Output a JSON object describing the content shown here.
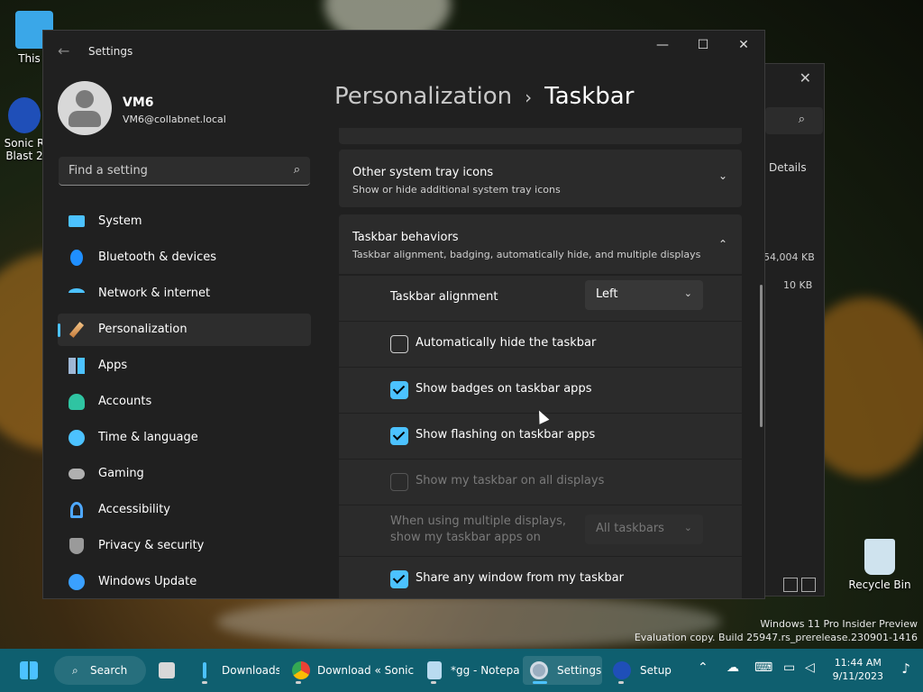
{
  "desktop": {
    "icons": [
      {
        "label": "This P"
      },
      {
        "label": "Sonic R Blast 2"
      },
      {
        "label": "Recycle Bin"
      }
    ],
    "watermark_line1": "Windows 11 Pro Insider Preview",
    "watermark_line2": "Evaluation copy. Build 25947.rs_prerelease.230901-1416"
  },
  "bg_window": {
    "close": "✕",
    "search_icon": "search-icon",
    "details": "Details",
    "sizes": [
      "54,004 KB",
      "10 KB"
    ]
  },
  "window": {
    "title": "Settings",
    "back": "←",
    "minimize": "—",
    "maximize": "☐",
    "close": "✕"
  },
  "profile": {
    "name": "VM6",
    "email": "VM6@collabnet.local"
  },
  "search": {
    "placeholder": "Find a setting",
    "icon": "⌕"
  },
  "sidebar": {
    "items": [
      {
        "label": "System",
        "icon": "monitor-icon",
        "color": "#4cc2ff"
      },
      {
        "label": "Bluetooth & devices",
        "icon": "bluetooth-icon",
        "color": "#1f8fff"
      },
      {
        "label": "Network & internet",
        "icon": "wifi-icon",
        "color": "#4cc2ff"
      },
      {
        "label": "Personalization",
        "icon": "brush-icon",
        "color": "#e8a86a",
        "active": true
      },
      {
        "label": "Apps",
        "icon": "apps-icon",
        "color": "#9fb8d6"
      },
      {
        "label": "Accounts",
        "icon": "person-icon",
        "color": "#2fc4a2"
      },
      {
        "label": "Time & language",
        "icon": "globe-clock-icon",
        "color": "#4cc2ff"
      },
      {
        "label": "Gaming",
        "icon": "gamepad-icon",
        "color": "#b0b0b0"
      },
      {
        "label": "Accessibility",
        "icon": "accessibility-icon",
        "color": "#4ea8ff"
      },
      {
        "label": "Privacy & security",
        "icon": "shield-icon",
        "color": "#9a9a9a"
      },
      {
        "label": "Windows Update",
        "icon": "update-icon",
        "color": "#3aa0ff"
      }
    ]
  },
  "header": {
    "breadcrumb": "Personalization",
    "separator": "›",
    "current": "Taskbar"
  },
  "content": {
    "tray_card": {
      "title": "Other system tray icons",
      "subtitle": "Show or hide additional system tray icons",
      "chevron": "⌄"
    },
    "behaviors_card": {
      "title": "Taskbar behaviors",
      "subtitle": "Taskbar alignment, badging, automatically hide, and multiple displays",
      "chevron": "⌃"
    },
    "alignment": {
      "label": "Taskbar alignment",
      "value": "Left",
      "chevron": "⌄"
    },
    "options": [
      {
        "label": "Automatically hide the taskbar",
        "checked": false,
        "disabled": false
      },
      {
        "label": "Show badges on taskbar apps",
        "checked": true,
        "disabled": false
      },
      {
        "label": "Show flashing on taskbar apps",
        "checked": true,
        "disabled": false
      },
      {
        "label": "Show my taskbar on all displays",
        "checked": false,
        "disabled": true
      }
    ],
    "multi_display": {
      "label_line1": "When using multiple displays,",
      "label_line2": "show my taskbar apps on",
      "value": "All taskbars",
      "chevron": "⌄"
    },
    "share_window": {
      "label": "Share any window from my taskbar",
      "checked": true
    }
  },
  "taskbar": {
    "search_label": "Search",
    "apps": [
      {
        "label": "Downloads"
      },
      {
        "label": "Download « Sonic R"
      },
      {
        "label": "*gg - Notepad"
      },
      {
        "label": "Settings"
      },
      {
        "label": "Setup"
      }
    ],
    "time": "11:44 AM",
    "date": "9/11/2023",
    "accent": "#0f5f6f"
  }
}
